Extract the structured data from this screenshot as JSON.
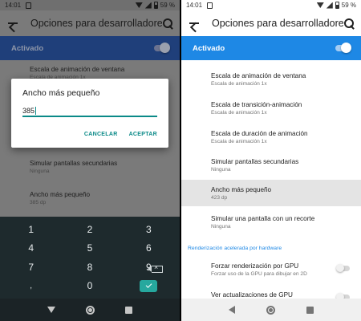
{
  "left": {
    "status": {
      "time": "14:01",
      "battery": "59 %"
    },
    "appbar": {
      "title": "Opciones para desarrolladores"
    },
    "master": {
      "label": "Activado",
      "on": true
    },
    "rows": [
      {
        "title": "Escala de animación de ventana",
        "subtitle": "Escala de animación 1x"
      },
      {
        "title": "Simular pantallas secundarias",
        "subtitle": "Ninguna"
      },
      {
        "title": "Ancho más pequeño",
        "subtitle": "385 dp"
      }
    ],
    "dialog": {
      "title": "Ancho más pequeño",
      "value": "385",
      "cancel": "CANCELAR",
      "accept": "ACEPTAR"
    },
    "keyboard": {
      "keys": [
        "1",
        "2",
        "3",
        "4",
        "5",
        "6",
        "7",
        "8",
        "9",
        ",",
        "0"
      ]
    }
  },
  "right": {
    "status": {
      "time": "14:01",
      "battery": "59 %"
    },
    "appbar": {
      "title": "Opciones para desarrolladores"
    },
    "master": {
      "label": "Activado",
      "on": true
    },
    "rows": [
      {
        "title": "Escala de animación de ventana",
        "subtitle": "Escala de animación 1x"
      },
      {
        "title": "Escala de transición-animación",
        "subtitle": "Escala de animación 1x"
      },
      {
        "title": "Escala de duración de animación",
        "subtitle": "Escala de animación 1x"
      },
      {
        "title": "Simular pantallas secundarias",
        "subtitle": "Ninguna"
      },
      {
        "title": "Ancho más pequeño",
        "subtitle": "423 dp"
      },
      {
        "title": "Simular una pantalla con un recorte",
        "subtitle": "Ninguna"
      }
    ],
    "section": "Renderización acelerada por hardware",
    "gpu_rows": [
      {
        "title": "Forzar renderización por GPU",
        "subtitle": "Forzar uso de la GPU para dibujar en 2D",
        "on": false
      },
      {
        "title": "Ver actualizaciones de GPU",
        "subtitle": "",
        "on": false
      }
    ]
  },
  "colors": {
    "accent_blue": "#1e88e5",
    "teal": "#0b8a88",
    "keyboard_bg": "#1e2a2d"
  }
}
